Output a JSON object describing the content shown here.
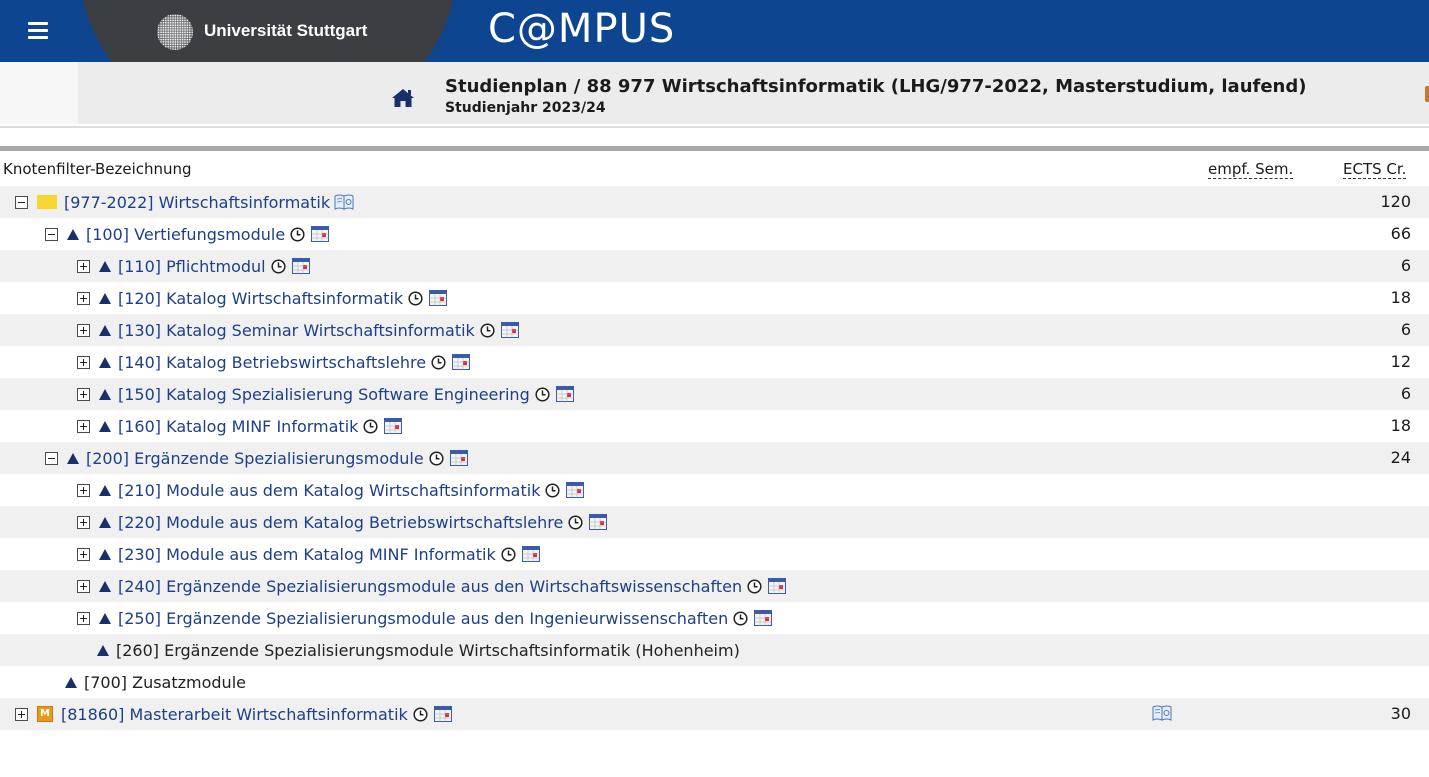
{
  "header": {
    "university": "Universität Stuttgart",
    "app_name": "C@MPUS",
    "menu_icon": "hamburger-menu-icon",
    "home_icon": "home-icon"
  },
  "breadcrumb": {
    "title": "Studienplan  / 88 977 Wirtschaftsinformatik (LHG/977-2022, Masterstudium, laufend)",
    "subtitle": "Studienjahr 2023/24"
  },
  "columns": {
    "name": "Knotenfilter-Bezeichnung",
    "sem": "empf. Sem.",
    "ects": "ECTS Cr."
  },
  "rows": [
    {
      "label": "[977-2022] Wirtschaftsinformatik",
      "ects": "120"
    },
    {
      "label": "[100] Vertiefungsmodule",
      "ects": "66"
    },
    {
      "label": "[110] Pflichtmodul",
      "ects": "6"
    },
    {
      "label": "[120] Katalog Wirtschaftsinformatik",
      "ects": "18"
    },
    {
      "label": "[130] Katalog Seminar Wirtschaftsinformatik",
      "ects": "6"
    },
    {
      "label": "[140] Katalog Betriebswirtschaftslehre",
      "ects": "12"
    },
    {
      "label": "[150] Katalog Spezialisierung Software Engineering",
      "ects": "6"
    },
    {
      "label": "[160] Katalog MINF Informatik",
      "ects": "18"
    },
    {
      "label": "[200] Ergänzende Spezialisierungsmodule",
      "ects": "24"
    },
    {
      "label": "[210] Module aus dem Katalog Wirtschaftsinformatik",
      "ects": ""
    },
    {
      "label": "[220] Module aus dem Katalog Betriebswirtschaftslehre",
      "ects": ""
    },
    {
      "label": "[230] Module aus dem Katalog MINF Informatik",
      "ects": ""
    },
    {
      "label": "[240] Ergänzende Spezialisierungsmodule aus den Wirtschaftswissenschaften",
      "ects": ""
    },
    {
      "label": "[250] Ergänzende Spezialisierungsmodule aus den Ingenieurwissenschaften",
      "ects": ""
    },
    {
      "label": "[260] Ergänzende Spezialisierungsmodule Wirtschaftsinformatik (Hohenheim)",
      "ects": ""
    },
    {
      "label": "[700] Zusatzmodule",
      "ects": ""
    },
    {
      "label": "[81860] Masterarbeit Wirtschaftsinformatik",
      "badge": "M",
      "ects": "30"
    }
  ],
  "colors": {
    "header_blue": "#0e4591",
    "link_blue": "#1c3f8a",
    "triangle": "#17306a",
    "folder_yellow": "#f7d631",
    "module_orange": "#e59c1c"
  }
}
